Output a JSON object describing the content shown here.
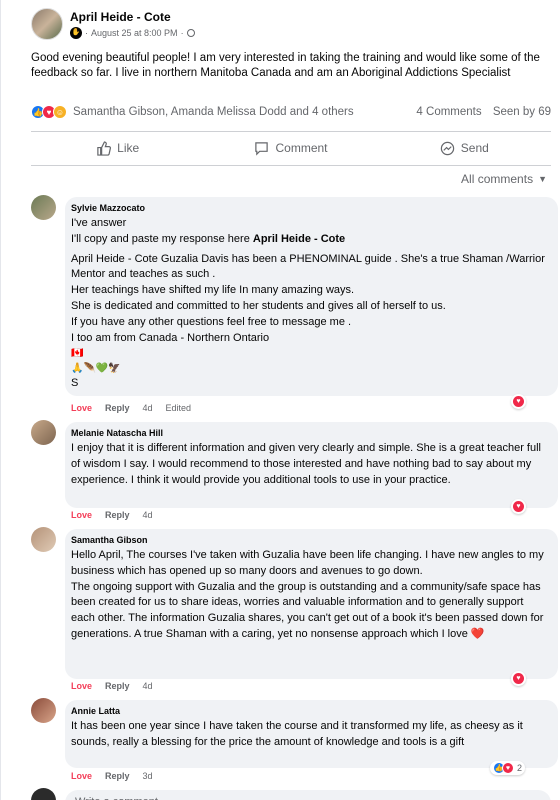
{
  "post": {
    "author": "April Heide - Cote",
    "date": "August 25 at 8:00 PM",
    "separator": "·",
    "text": "Good evening beautiful people!  I am very interested in taking the training and would like some of the feedback so far.  I live in northern Manitoba Canada and am an Aboriginal Addictions Specialist",
    "reaction_names": "Samantha Gibson, Amanda Melissa Dodd and 4 others",
    "comments_count": "4 Comments",
    "seen_by": "Seen by 69"
  },
  "actions": {
    "like": "Like",
    "comment": "Comment",
    "send": "Send"
  },
  "sort_label": "All comments",
  "comment_actions": {
    "love": "Love",
    "reply": "Reply"
  },
  "comments": [
    {
      "name": "Sylvie Mazzocato",
      "line1": "I've answer",
      "line2_prefix": "I'll copy and paste my response here ",
      "line2_tag": "April Heide - Cote",
      "body": "April Heide - Cote Guzalia Davis has been a PHENOMINAL guide . She's a true Shaman /Warrior Mentor and teaches as such .\nHer teachings have shifted my life In many amazing ways.\nShe is dedicated and committed to her students and gives all of herself to us.\nIf you have any other questions feel free to message me .\nI too am from Canada - Northern Ontario",
      "flag": "🇨🇦",
      "emojis": "🙏🪶💚🦅",
      "signoff": "S",
      "time": "4d",
      "edited": "Edited"
    },
    {
      "name": "Melanie Natascha Hill",
      "body": "I enjoy that it is different information and given very clearly and simple. She is a great teacher full of wisdom I say. I would recommend to those interested and have nothing bad to say about my experience. I think it would provide you additional tools to use in your practice.",
      "time": "4d"
    },
    {
      "name": "Samantha Gibson",
      "body": "Hello April, The courses I've taken with Guzalia have been life changing. I have new angles to my business which has opened up so many doors and avenues to go down.\nThe ongoing support with Guzalia and the group is outstanding and a community/safe space has been created for us to share ideas, worries and valuable information and to generally support each other. The information Guzalia shares, you can't get out of a book it's been passed down for generations. A true Shaman with a caring, yet no nonsense approach which I love",
      "heart": "❤️",
      "time": "4d"
    },
    {
      "name": "Annie Latta",
      "body": "It has been one year since I have taken the course and it transformed my life, as cheesy as it sounds, really a blessing for the price the amount of knowledge and tools is a gift",
      "time": "3d",
      "reaction_count": "2"
    }
  ],
  "write_placeholder": "Write a comment...",
  "colors": {
    "love": "#f33e58",
    "like_blue": "#1877f2",
    "bubble_bg": "#f0f2f5",
    "muted": "#65676b"
  }
}
